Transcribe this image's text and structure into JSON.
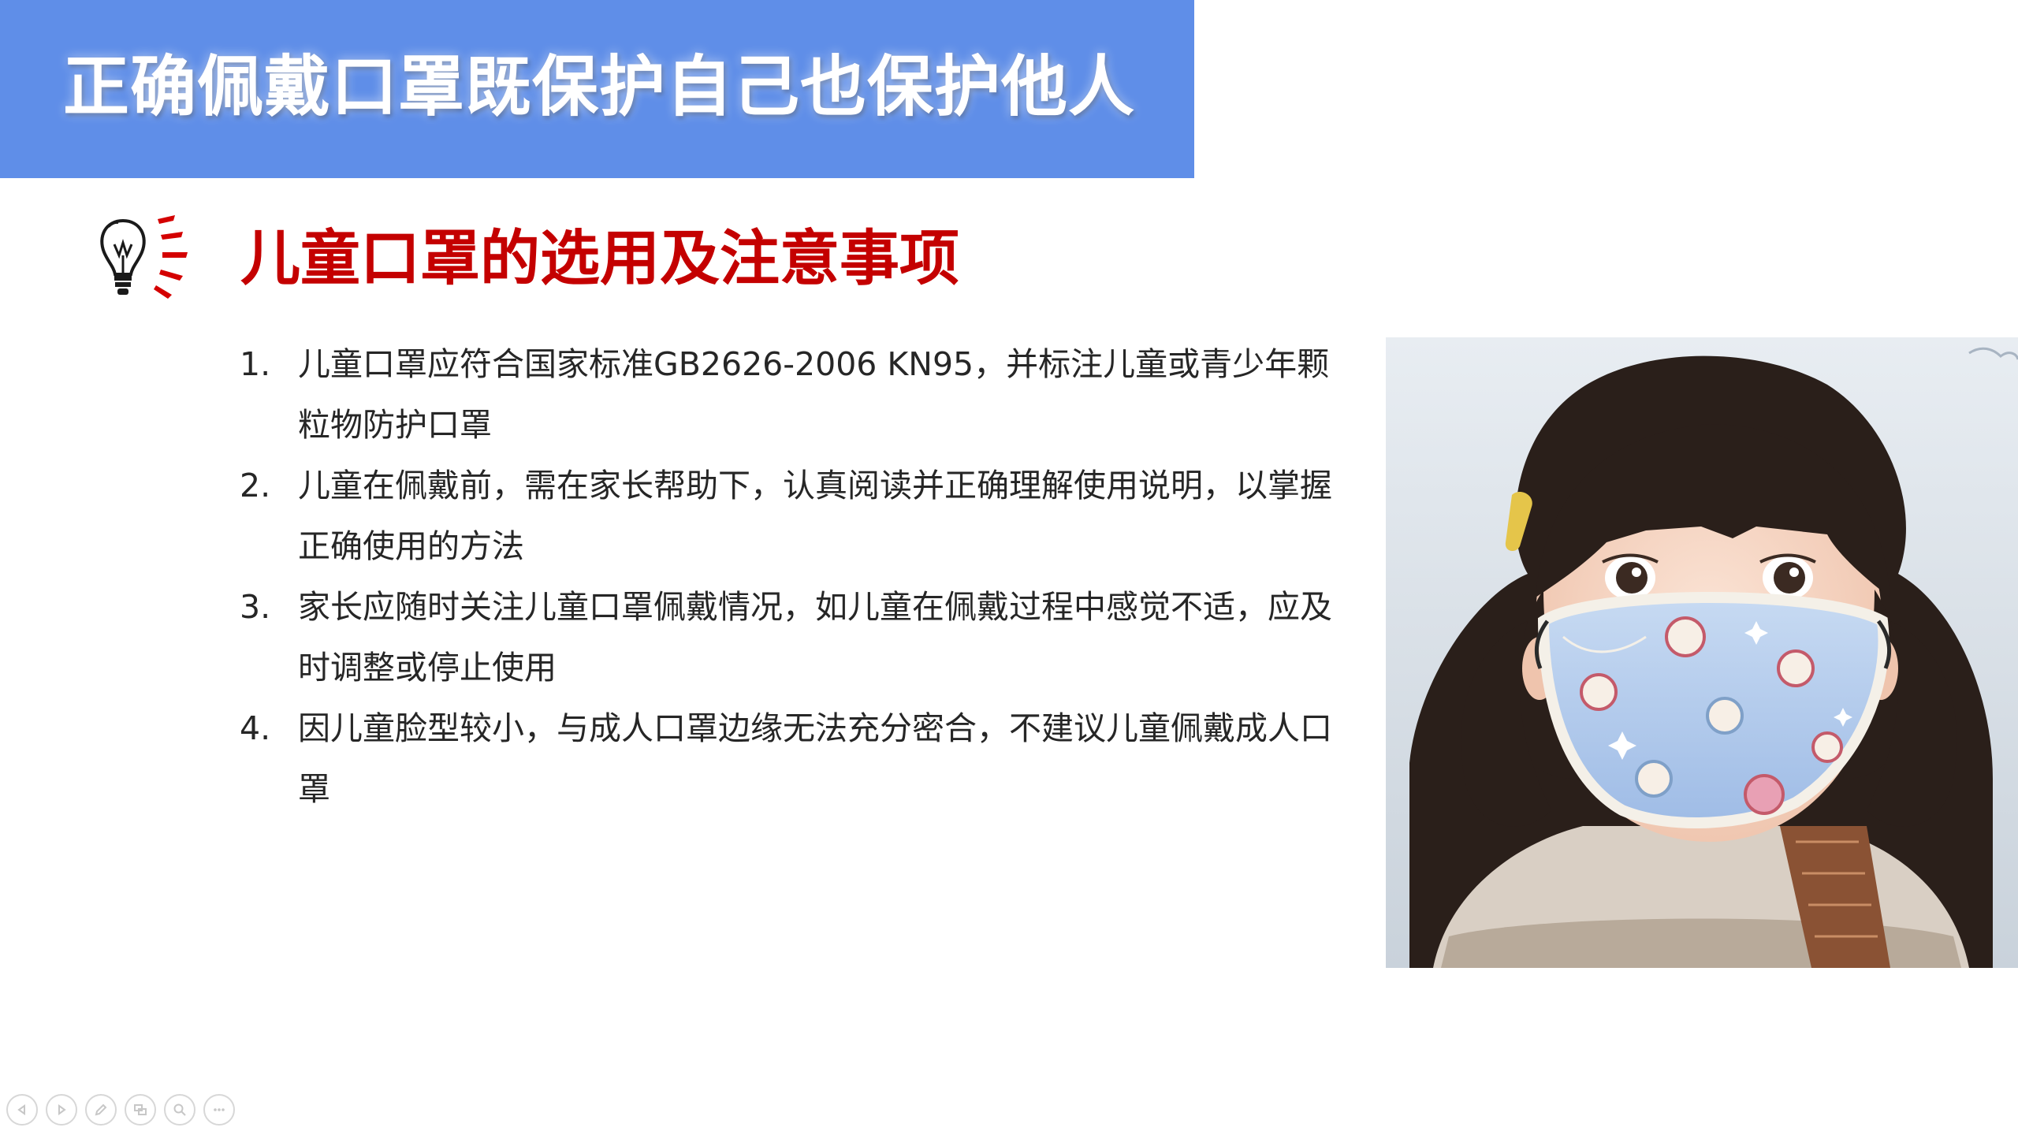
{
  "slide": {
    "title": "正确佩戴口罩既保护自己也保护他人",
    "section_heading": "儿童口罩的选用及注意事项",
    "notes": [
      {
        "num": "1.",
        "text": "儿童口罩应符合国家标准GB2626-2006  KN95，并标注儿童或青少年颗粒物防护口罩"
      },
      {
        "num": "2.",
        "text": "儿童在佩戴前，需在家长帮助下，认真阅读并正确理解使用说明，以掌握正确使用的方法"
      },
      {
        "num": "3.",
        "text": "家长应随时关注儿童口罩佩戴情况，如儿童在佩戴过程中感觉不适，应及时调整或停止使用"
      },
      {
        "num": "4.",
        "text": "因儿童脸型较小，与成人口罩边缘无法充分密合，不建议儿童佩戴成人口罩"
      }
    ]
  },
  "colors": {
    "banner": "#5f8ee8",
    "heading": "#c40000",
    "body_text": "#262626"
  },
  "nav_icons": [
    "previous-slide-icon",
    "next-slide-icon",
    "pen-icon",
    "slides-grid-icon",
    "zoom-icon",
    "more-options-icon"
  ]
}
